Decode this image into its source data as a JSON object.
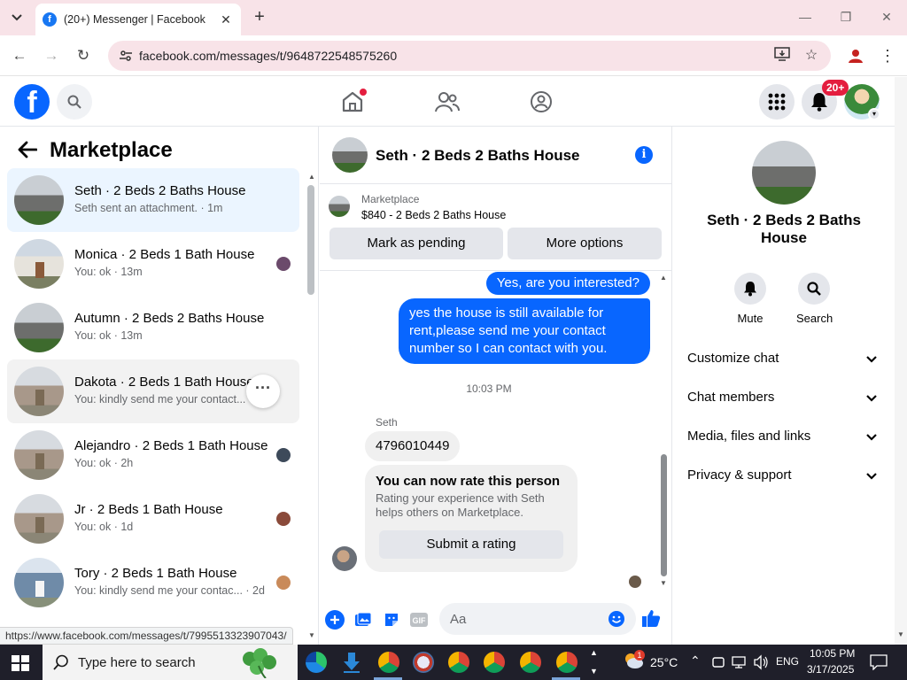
{
  "browser": {
    "tab_title": "(20+) Messenger | Facebook",
    "url": "facebook.com/messages/t/9648722548575260",
    "status_url": "https://www.facebook.com/messages/t/7995513323907043/"
  },
  "fb": {
    "notification_badge": "20+"
  },
  "sidebar": {
    "title": "Marketplace",
    "chats": [
      {
        "name": "Seth · 2 Beds 2 Baths House",
        "preview": "Seth sent an attachment. · 1m"
      },
      {
        "name": "Monica · 2 Beds 1 Bath House",
        "preview": "You: ok · 13m"
      },
      {
        "name": "Autumn · 2 Beds 2 Baths House",
        "preview": "You: ok · 13m"
      },
      {
        "name": "Dakota · 2 Beds 1 Bath House",
        "preview": "You: kindly send me your contact... · 1m"
      },
      {
        "name": "Alejandro · 2 Beds 1 Bath House",
        "preview": "You: ok · 2h"
      },
      {
        "name": "Jr · 2 Beds 1 Bath House",
        "preview": "You: ok · 1d"
      },
      {
        "name": "Tory · 2 Beds 1 Bath House",
        "preview": "You: kindly send me your contac... · 2d"
      }
    ]
  },
  "conversation": {
    "title": "Seth · 2 Beds 2 Baths House",
    "listing_source": "Marketplace",
    "listing_title": "$840 - 2 Beds 2 Baths House",
    "mark_pending_label": "Mark as pending",
    "more_options_label": "More options",
    "messages": {
      "out_1": "Yes, are you interested?",
      "out_2": "yes the house is still available for rent,please send me your contact number so I can contact with you.",
      "timestamp": "10:03 PM",
      "sender": "Seth",
      "in_1": "4796010449",
      "rate_title": "You can now rate this person",
      "rate_desc": "Rating your experience with Seth helps others on Marketplace.",
      "rate_button": "Submit a rating"
    },
    "composer_placeholder": "Aa"
  },
  "details": {
    "name": "Seth · 2 Beds 2 Baths House",
    "mute_label": "Mute",
    "search_label": "Search",
    "sections": [
      "Customize chat",
      "Chat members",
      "Media, files and links",
      "Privacy & support"
    ]
  },
  "taskbar": {
    "search_placeholder": "Type here to search",
    "weather": "25°C",
    "weather_badge": "1",
    "language": "ENG",
    "time": "10:05 PM",
    "date": "3/17/2025"
  }
}
